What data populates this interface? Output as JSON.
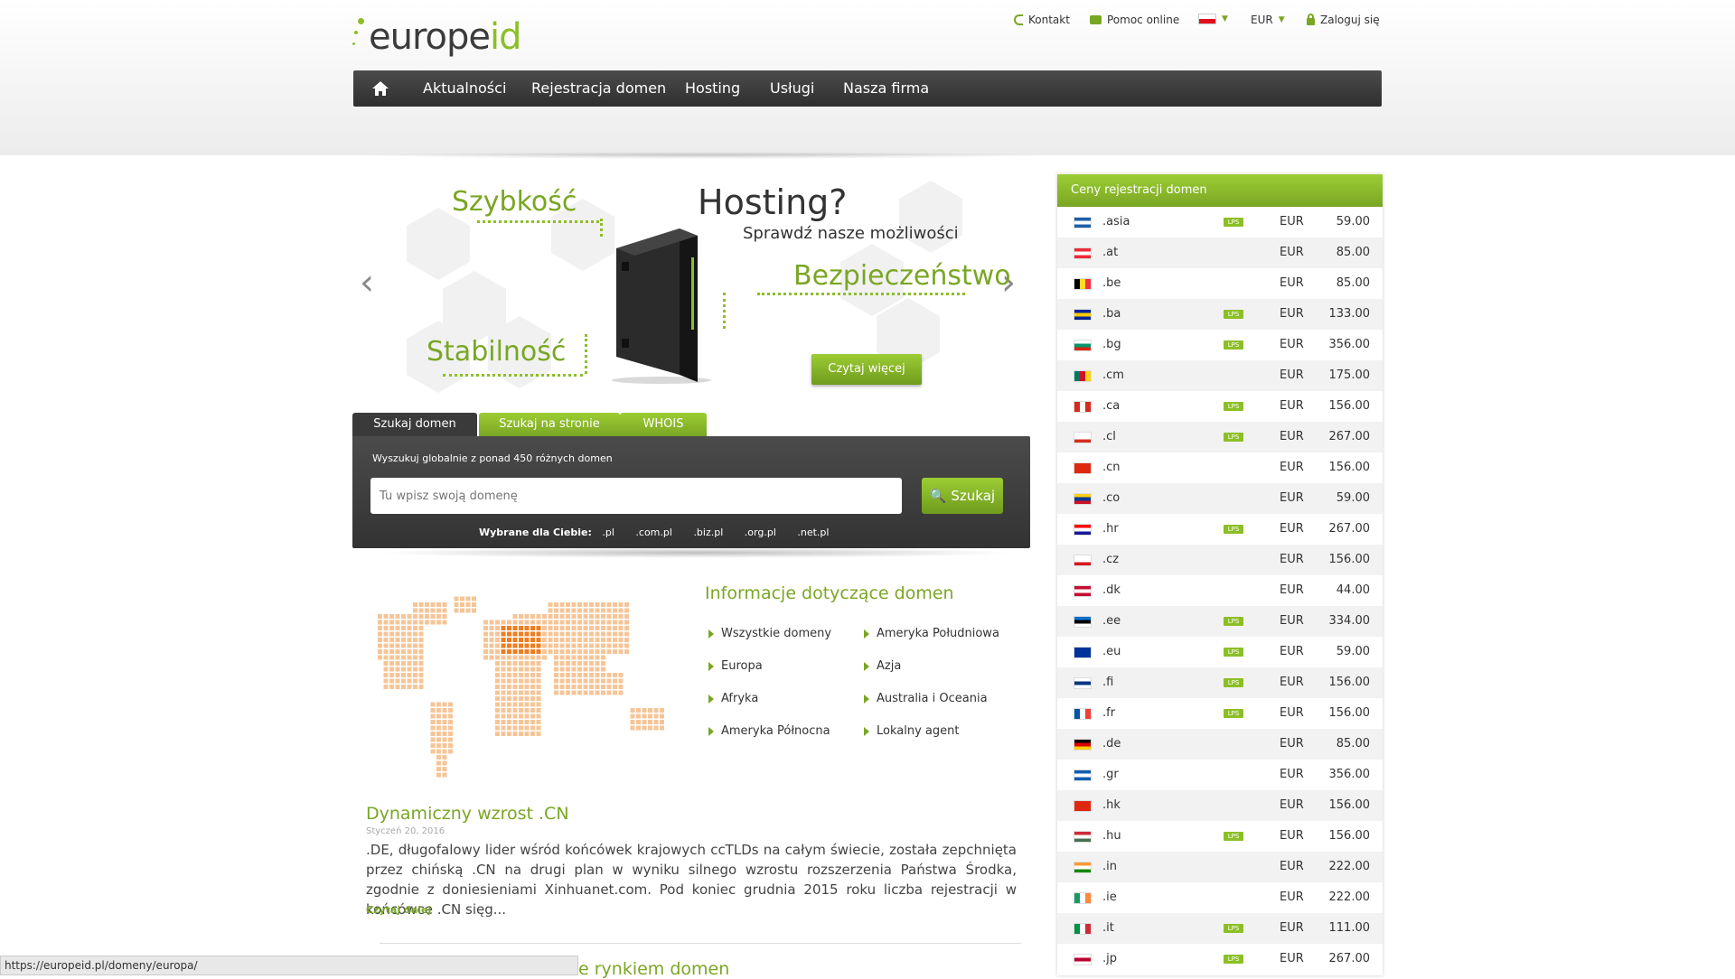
{
  "logo": {
    "text_main": "europe",
    "text_accent": "id"
  },
  "toplinks": {
    "contact": "Kontakt",
    "help": "Pomoc online",
    "currency": "EUR",
    "login": "Zaloguj się"
  },
  "nav": {
    "items": [
      "Aktualności",
      "Rejestracja domen",
      "Hosting",
      "Usługi",
      "Nasza firma"
    ]
  },
  "hero": {
    "title": "Hosting?",
    "subtitle": "Sprawdź nasze możliwości",
    "word_speed": "Szybkość",
    "word_security": "Bezpieczeństwo",
    "word_stability": "Stabilność",
    "read_more": "Czytaj więcej"
  },
  "search": {
    "tabs": [
      "Szukaj domen",
      "Szukaj na stronie",
      "WHOIS"
    ],
    "hint": "Wyszukuj globalnie z ponad 450 różnych domen",
    "placeholder": "Tu wpisz swoją domenę",
    "button": "Szukaj",
    "suggest_label": "Wybrane dla Ciebie:",
    "suggest": [
      ".pl",
      ".com.pl",
      ".biz.pl",
      ".org.pl",
      ".net.pl"
    ]
  },
  "info": {
    "title": "Informacje dotyczące domen",
    "links": [
      "Wszystkie domeny",
      "Ameryka Południowa",
      "Europa",
      "Azja",
      "Afryka",
      "Australia i Oceania",
      "Ameryka Północna",
      "Lokalny agent"
    ]
  },
  "news": {
    "title": "Dynamiczny wzrost .CN",
    "date": "Styczeń 20, 2016",
    "body": ".DE, długofalowy lider wśród końcówek krajowych ccTLDs na całym świecie, została zepchnięta przez chińską .CN na drugi plan w wyniku silnego wzrostu rozszerzenia Państwa Środka, zgodnie z doniesieniami Xinhuanet.com. Pod koniec grudnia 2015 roku liczba rejestracji w końcówce .CN sięg...",
    "more": "Czytaj dalej",
    "next_title_partial": "e rynkiem domen"
  },
  "statusbar": {
    "url": "https://europeid.pl/domeny/europa/"
  },
  "prices": {
    "title": "Ceny rejestracji domen",
    "lps_label": "LPS",
    "rows": [
      {
        "tld": ".asia",
        "lps": true,
        "currency": "EUR",
        "price": "59.00",
        "flag": [
          "#1c5fa8",
          "#ffffff",
          "#1c5fa8"
        ]
      },
      {
        "tld": ".at",
        "lps": false,
        "currency": "EUR",
        "price": "85.00",
        "flag": [
          "#ed2939",
          "#ffffff",
          "#ed2939"
        ]
      },
      {
        "tld": ".be",
        "lps": false,
        "currency": "EUR",
        "price": "85.00",
        "flag": [
          "#000000",
          "#fdda24",
          "#ef3340"
        ],
        "vertical": true
      },
      {
        "tld": ".ba",
        "lps": true,
        "currency": "EUR",
        "price": "133.00",
        "flag": [
          "#002395",
          "#fecb00",
          "#002395"
        ]
      },
      {
        "tld": ".bg",
        "lps": true,
        "currency": "EUR",
        "price": "356.00",
        "flag": [
          "#ffffff",
          "#00966e",
          "#d62612"
        ]
      },
      {
        "tld": ".cm",
        "lps": false,
        "currency": "EUR",
        "price": "175.00",
        "flag": [
          "#007a5e",
          "#ce1126",
          "#fcd116"
        ],
        "vertical": true
      },
      {
        "tld": ".ca",
        "lps": true,
        "currency": "EUR",
        "price": "156.00",
        "flag": [
          "#d52b1e",
          "#ffffff",
          "#d52b1e"
        ],
        "vertical": true
      },
      {
        "tld": ".cl",
        "lps": true,
        "currency": "EUR",
        "price": "267.00",
        "flag": [
          "#ffffff",
          "#ffffff",
          "#d52b1e"
        ]
      },
      {
        "tld": ".cn",
        "lps": false,
        "currency": "EUR",
        "price": "156.00",
        "flag": [
          "#de2910",
          "#de2910",
          "#de2910"
        ]
      },
      {
        "tld": ".co",
        "lps": false,
        "currency": "EUR",
        "price": "59.00",
        "flag": [
          "#fcd116",
          "#003893",
          "#ce1126"
        ]
      },
      {
        "tld": ".hr",
        "lps": true,
        "currency": "EUR",
        "price": "267.00",
        "flag": [
          "#ff0000",
          "#ffffff",
          "#171796"
        ]
      },
      {
        "tld": ".cz",
        "lps": false,
        "currency": "EUR",
        "price": "156.00",
        "flag": [
          "#ffffff",
          "#ffffff",
          "#d7141a"
        ]
      },
      {
        "tld": ".dk",
        "lps": false,
        "currency": "EUR",
        "price": "44.00",
        "flag": [
          "#c60c30",
          "#ffffff",
          "#c60c30"
        ]
      },
      {
        "tld": ".ee",
        "lps": true,
        "currency": "EUR",
        "price": "334.00",
        "flag": [
          "#0072ce",
          "#000000",
          "#ffffff"
        ]
      },
      {
        "tld": ".eu",
        "lps": true,
        "currency": "EUR",
        "price": "59.00",
        "flag": [
          "#003399",
          "#003399",
          "#003399"
        ]
      },
      {
        "tld": ".fi",
        "lps": true,
        "currency": "EUR",
        "price": "156.00",
        "flag": [
          "#ffffff",
          "#003580",
          "#ffffff"
        ]
      },
      {
        "tld": ".fr",
        "lps": true,
        "currency": "EUR",
        "price": "156.00",
        "flag": [
          "#0055a4",
          "#ffffff",
          "#ef4135"
        ],
        "vertical": true
      },
      {
        "tld": ".de",
        "lps": false,
        "currency": "EUR",
        "price": "85.00",
        "flag": [
          "#000000",
          "#dd0000",
          "#ffce00"
        ]
      },
      {
        "tld": ".gr",
        "lps": false,
        "currency": "EUR",
        "price": "356.00",
        "flag": [
          "#0d5eaf",
          "#ffffff",
          "#0d5eaf"
        ]
      },
      {
        "tld": ".hk",
        "lps": false,
        "currency": "EUR",
        "price": "156.00",
        "flag": [
          "#de2910",
          "#de2910",
          "#de2910"
        ]
      },
      {
        "tld": ".hu",
        "lps": true,
        "currency": "EUR",
        "price": "156.00",
        "flag": [
          "#ce2939",
          "#ffffff",
          "#477050"
        ]
      },
      {
        "tld": ".in",
        "lps": false,
        "currency": "EUR",
        "price": "222.00",
        "flag": [
          "#ff9933",
          "#ffffff",
          "#138808"
        ]
      },
      {
        "tld": ".ie",
        "lps": false,
        "currency": "EUR",
        "price": "222.00",
        "flag": [
          "#169b62",
          "#ffffff",
          "#ff883e"
        ],
        "vertical": true
      },
      {
        "tld": ".it",
        "lps": true,
        "currency": "EUR",
        "price": "111.00",
        "flag": [
          "#009246",
          "#ffffff",
          "#ce2b37"
        ],
        "vertical": true
      },
      {
        "tld": ".jp",
        "lps": true,
        "currency": "EUR",
        "price": "267.00",
        "flag": [
          "#ffffff",
          "#bc002d",
          "#ffffff"
        ]
      }
    ]
  }
}
